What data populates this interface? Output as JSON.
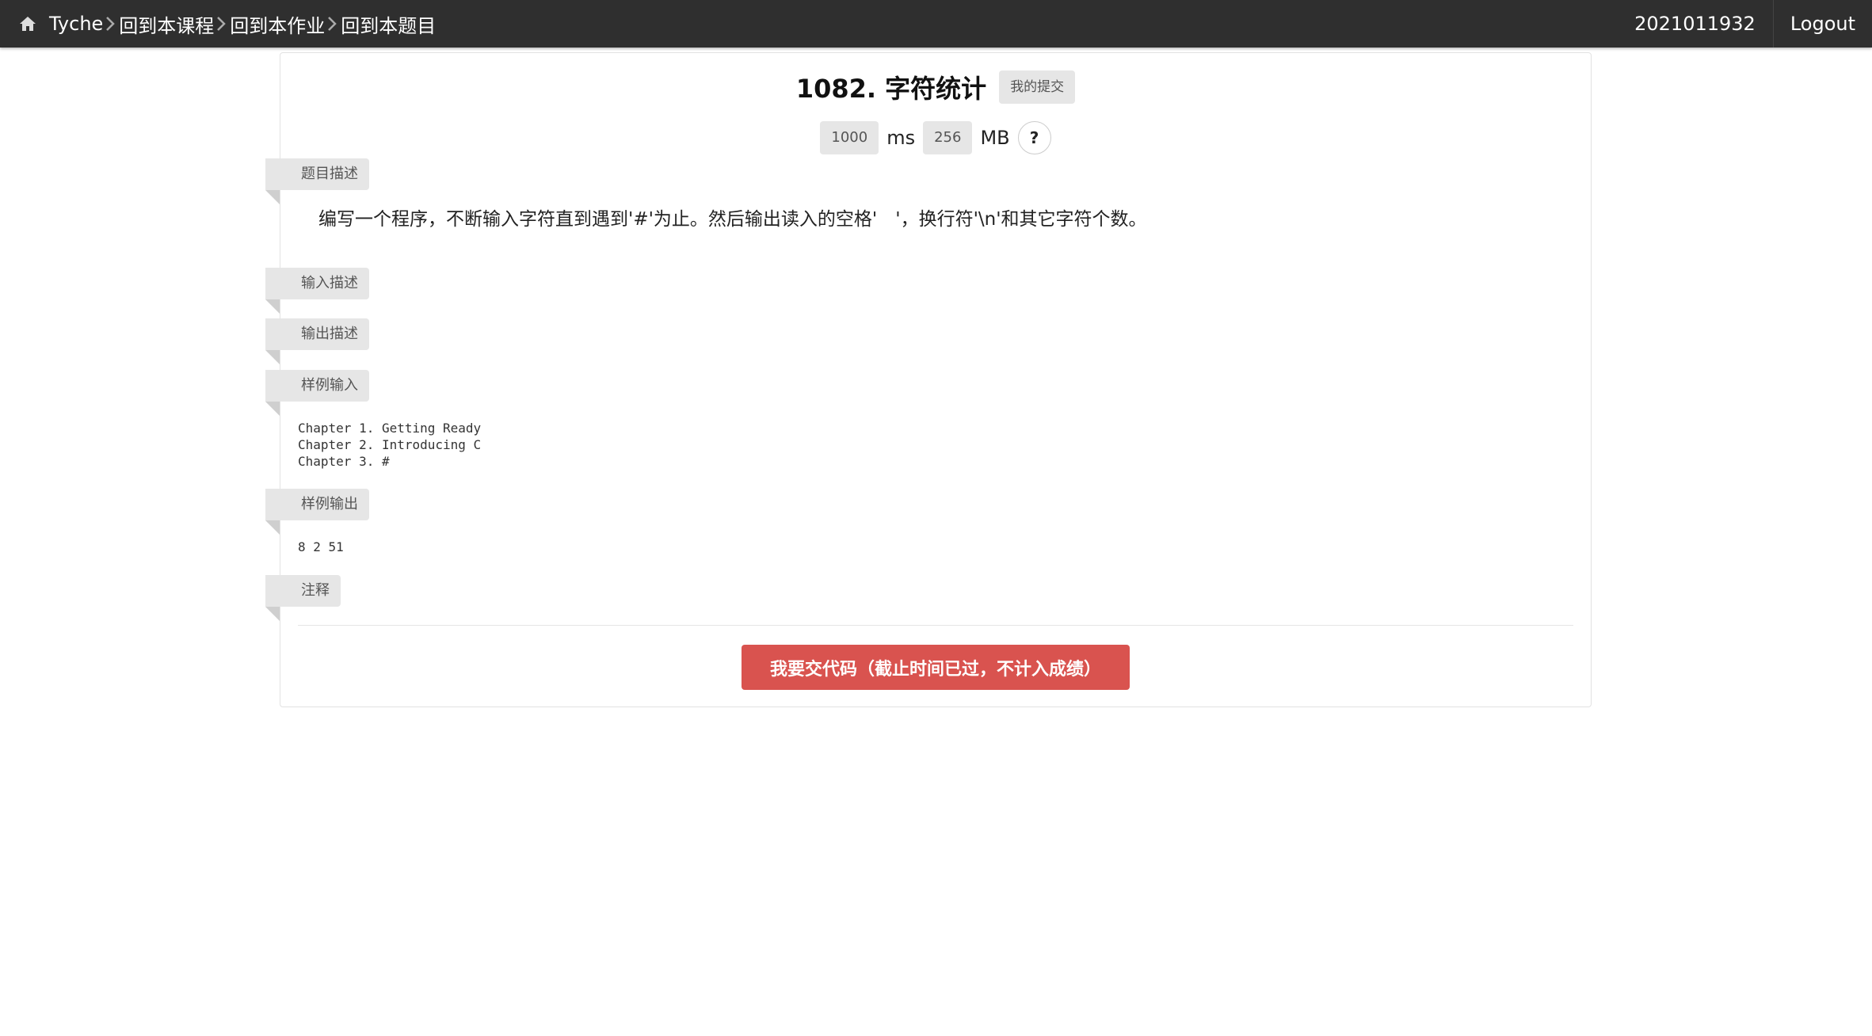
{
  "navbar": {
    "brand": "Tyche",
    "breadcrumbs": [
      "回到本课程",
      "回到本作业",
      "回到本题目"
    ],
    "username": "2021011932",
    "logout": "Logout"
  },
  "problem": {
    "title": "1082. 字符统计",
    "my_submissions": "我的提交",
    "time_limit": "1000",
    "time_unit": "ms",
    "memory_limit": "256",
    "memory_unit": "MB",
    "help": "?"
  },
  "sections": {
    "description_label": "题目描述",
    "description_text": "编写一个程序，不断输入字符直到遇到'#'为止。然后输出读入的空格'　'，换行符'\\n'和其它字符个数。",
    "input_label": "输入描述",
    "output_label": "输出描述",
    "sample_input_label": "样例输入",
    "sample_input": "Chapter 1. Getting Ready\nChapter 2. Introducing C\nChapter 3. #",
    "sample_output_label": "样例输出",
    "sample_output": "8 2 51",
    "notes_label": "注释"
  },
  "submit": {
    "label": "我要交代码（截止时间已过，不计入成绩）"
  },
  "colors": {
    "navbar_bg": "#2f2f2f",
    "ribbon_bg": "#e6e6e6",
    "danger": "#d9534f"
  },
  "icons": {
    "home": "home-icon",
    "breadcrumb_separator": "chevron-right-icon"
  }
}
